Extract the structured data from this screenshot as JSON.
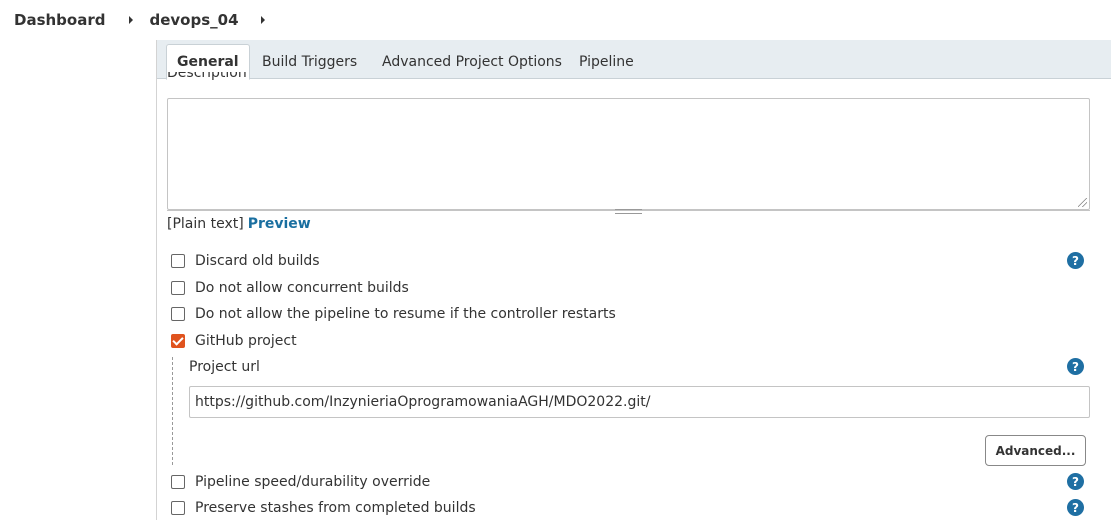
{
  "breadcrumb": {
    "items": [
      "Dashboard",
      "devops_04"
    ]
  },
  "tabs": [
    "General",
    "Build Triggers",
    "Advanced Project Options",
    "Pipeline"
  ],
  "description": {
    "label": "Description",
    "value": ""
  },
  "format": {
    "plain": "[Plain text]",
    "preview": "Preview"
  },
  "options": {
    "discard": "Discard old builds",
    "concurrent": "Do not allow concurrent builds",
    "resume": "Do not allow the pipeline to resume if the controller restarts",
    "github": "GitHub project",
    "speed": "Pipeline speed/durability override",
    "stashes": "Preserve stashes from completed builds"
  },
  "checked": {
    "github": true
  },
  "github_project": {
    "label": "Project url",
    "url": "https://github.com/InzynieriaOprogramowaniaAGH/MDO2022.git/",
    "advanced": "Advanced..."
  },
  "help_glyph": "?",
  "colors": {
    "accent_checkbox": "#e0531e",
    "link": "#1a6fa0",
    "help": "#1f6fa3",
    "tabbar": "#e7edf1"
  }
}
